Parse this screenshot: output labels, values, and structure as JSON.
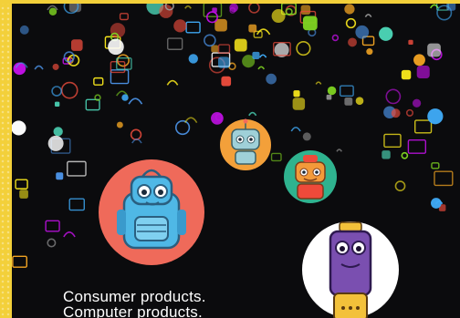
{
  "caption": {
    "line1": "Consumer products.",
    "line2": "Computer products."
  },
  "colors": {
    "border": "#f3d03a",
    "background": "#0b0b0d",
    "circle_coral": "#ef6a5a",
    "circle_orange": "#f3a03a",
    "circle_teal": "#2fb38f",
    "circle_white": "#ffffff",
    "robot_blue": "#4fb8e6",
    "robot_purple": "#7a4fb0",
    "robot_orange": "#f39a3a",
    "robot_gold": "#f3c13a"
  },
  "illustration": {
    "icons": [
      "wifi-icon",
      "mail-icon",
      "monitor-icon",
      "phone-icon",
      "camera-icon",
      "power-icon",
      "gear-icon",
      "cloud-icon",
      "chat-icon",
      "cart-icon",
      "paperclip-icon",
      "headphones-icon",
      "globe-icon",
      "at-sign-icon",
      "lightbulb-icon",
      "lock-icon"
    ],
    "robots": [
      "backpack-robot",
      "small-orange-robot",
      "small-red-robot",
      "purple-robot"
    ]
  }
}
